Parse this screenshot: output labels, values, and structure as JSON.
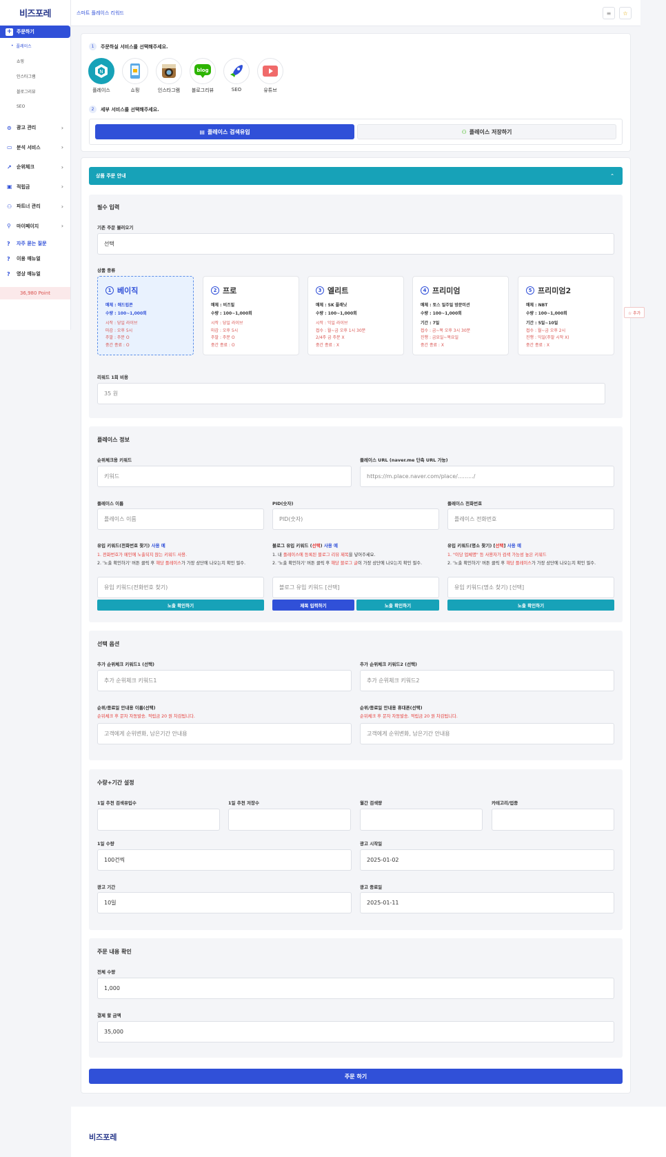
{
  "sidebar": {
    "logo": "비즈포레",
    "active": "주문하기",
    "submenu": [
      "플레이스",
      "쇼핑",
      "인스타그램",
      "블로그리뷰",
      "SEO"
    ],
    "items": [
      "광고 관리",
      "분석 서비스",
      "순위체크",
      "적립금",
      "파트너 관리",
      "마이페이지"
    ],
    "links": [
      "자주 묻는 질문",
      "이용 매뉴얼",
      "영상 매뉴얼"
    ],
    "points": "36,980 Point"
  },
  "header": {
    "title": "스마트 플레이스 리워드"
  },
  "services": {
    "step1": "주문하실 서비스를 선택해주세요.",
    "items": [
      "플레이스",
      "쇼핑",
      "인스타그램",
      "블로그리뷰",
      "SEO",
      "유튜브"
    ],
    "step2": "세부 서비스를 선택해주세요.",
    "tab_active": "플레이스 검색유입",
    "tab_inactive": "플레이스 저장하기"
  },
  "guide": "상품 주문 안내",
  "required": {
    "title": "필수 입력",
    "load_label": "기존 주문 불러오기",
    "load_value": "선택",
    "type_label": "상품 종류",
    "cards": [
      {
        "num": "1",
        "name": "베이직",
        "l1": "매체 : 애드립콘",
        "l2": "수량 : 100~1,000회",
        "r": [
          "시작 : 당일 라이브",
          "마감 : 오후 5시",
          "주말 : 주문 O",
          "중간 종료 : O"
        ]
      },
      {
        "num": "2",
        "name": "프로",
        "l1": "매체 : 비즈빌",
        "l2": "수량 : 100~1,000회",
        "r": [
          "시작 : 당일 라이브",
          "마감 : 오후 5시",
          "주말 : 주문 O",
          "중간 종료 : O"
        ]
      },
      {
        "num": "3",
        "name": "엘리트",
        "l1": "매체 : SK 플래닛",
        "l2": "수량 : 100~1,000회",
        "r": [
          "시작 : 익일 라이브",
          "접수 : 월~금 오후 1시 30분",
          "2/4주 금 주문 X",
          "중간 종료 : X"
        ]
      },
      {
        "num": "4",
        "name": "프리미엄",
        "l1": "매체 : 토스 일주일 방문미션",
        "l2": "수량 : 100~1,000회",
        "k": "기간 : 7일",
        "r": [
          "접수 : 금~목 오후 3시 30분",
          "진행 : 금요일~목요일",
          "중간 종료 : X"
        ]
      },
      {
        "num": "5",
        "name": "프리미엄2",
        "l1": "매체 : NBT",
        "l2": "수량 : 100~1,000회",
        "k": "기간 : 5일~10일",
        "r": [
          "접수 : 월~금 오후 2시",
          "진행 : 익일(주말 시작 X)",
          "중간 종료 : X"
        ]
      }
    ],
    "cost_label": "리워드 1회 비용",
    "cost_value": "35 원",
    "side_chip": "☆ 추가"
  },
  "place": {
    "title": "플레이스 정보",
    "kw_label": "순위체크용 키워드",
    "kw_ph": "키워드",
    "url_label": "플레이스 URL (naver.me 단축 URL 가능)",
    "url_ph": "https://m.place.naver.com/place/........./",
    "name_label": "플레이스 이름",
    "name_ph": "플레이스 이름",
    "pid_label": "PID(숫자)",
    "pid_ph": "PID(숫자)",
    "phone_label": "플레이스 전화번호",
    "phone_ph": "플레이스 전화번호",
    "col1": {
      "label": "유입 키워드(전화번호 찾기)",
      "ex": "사용 예",
      "n1": "1. 전화번호가 메인에 노출되지 않는 키워드 사용.",
      "n2a": "2. '노출 확인하기' 버튼 클릭 후 ",
      "n2r": "해당 플레이스",
      "n2b": "가 가장 상단에 나오는지 확인 필수.",
      "ph": "유입 키워드(전화번호 찾기)",
      "btn": "노출 확인하기"
    },
    "col2": {
      "label": "블로그 유입 키워드 (",
      "sel": "선택",
      "label2": ")",
      "ex": "사용 예",
      "n1a": "1. 내 ",
      "n1r": "플레이스에 등록된 블로그 리뷰 제목",
      "n1b": "을 넣어주세요.",
      "n2a": "2. '노출 확인하기' 버튼 클릭 후 ",
      "n2r": "해당 블로그 글",
      "n2b": "이 가장 상단에 나오는지 확인 필수.",
      "ph": "블로그 유입 키워드 [선택]",
      "btn1": "제목 입력하기",
      "btn2": "노출 확인하기"
    },
    "col3": {
      "label": "유입 키워드(명소 찾기) [",
      "sel": "선택",
      "label2": "]",
      "ex": "사용 예",
      "n1": "1. \"이당 업체명\" 등 사용자가 검색 가능성 높은 키워드",
      "n2a": "2. '노출 확인하기' 버튼 클릭 후 ",
      "n2r": "해당 플레이스",
      "n2b": "가 가장 상단에 나오는지 확인 필수.",
      "ph": "유입 키워드(명소 찾기) [선택]",
      "btn": "노출 확인하기"
    }
  },
  "options": {
    "title": "선택 옵션",
    "k1_label": "추가 순위체크 키워드1 (선택)",
    "k1_ph": "추가 순위체크 키워드1",
    "k2_label": "추가 순위체크 키워드2 (선택)",
    "k2_ph": "추가 순위체크 키워드2",
    "n1_label": "순위/종료일 안내용 이름(선택)",
    "n1_note": "순위체크 후 문자 자동발송. 적립금 20 원 차감됩니다.",
    "n1_ph": "고객에게 순위변화, 남은기간 안내용",
    "n2_label": "순위/종료일 안내용 휴대폰(선택)",
    "n2_note": "순위체크 후 문자 자동발송. 적립금 20 원 차감됩니다.",
    "n2_ph": "고객에게 순위변화, 남은기간 안내용"
  },
  "qty": {
    "title": "수량+기간 설정",
    "h1": "1일 추천 검색유입수",
    "h2": "1일 추천 저장수",
    "h3": "월간 검색량",
    "h4": "카테고리/업종",
    "daily_label": "1일 수량",
    "daily_value": "100건씩",
    "start_label": "광고 시작일",
    "start_value": "2025-01-02",
    "period_label": "광고 기간",
    "period_value": "10일",
    "end_label": "광고 종료일",
    "end_value": "2025-01-11"
  },
  "confirm": {
    "title": "주문 내용 확인",
    "total_label": "전체 수량",
    "total_value": "1,000",
    "pay_label": "결제 할 금액",
    "pay_value": "35,000"
  },
  "order_button": "주문 하기",
  "footer_logo": "비즈포레"
}
